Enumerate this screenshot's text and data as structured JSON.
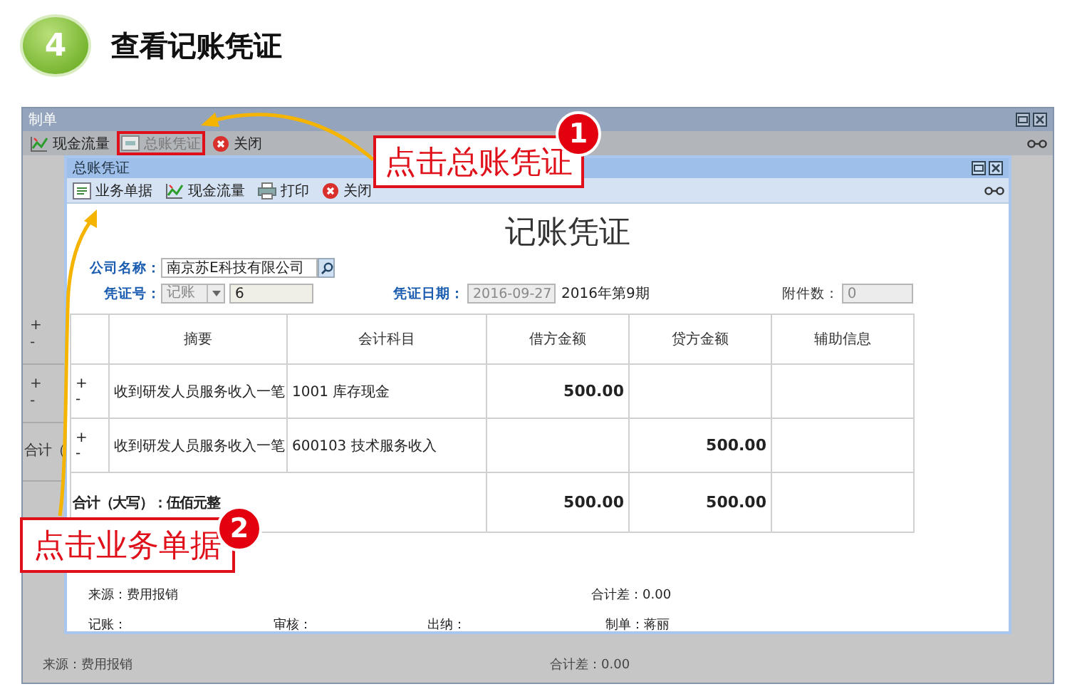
{
  "step": {
    "number": "4",
    "title": "查看记账凭证"
  },
  "outer_window": {
    "title": "制单",
    "toolbar": [
      {
        "label": "现金流量",
        "kind": "cashflow",
        "disabled": false,
        "highlighted": false
      },
      {
        "label": "总账凭证",
        "kind": "doc",
        "disabled": true,
        "highlighted": true
      },
      {
        "label": "关闭",
        "kind": "close",
        "disabled": false,
        "highlighted": false
      }
    ],
    "side_rows": [
      {
        "kind": "pm",
        "plus": "+",
        "minus": "-"
      },
      {
        "kind": "pm",
        "plus": "+",
        "minus": "-"
      },
      {
        "kind": "text",
        "text": "合计（"
      }
    ],
    "footer": {
      "source": "来源：费用报销",
      "diff": "合计差：0.00"
    }
  },
  "voucher_window": {
    "title": "总账凭证",
    "toolbar": [
      {
        "label": "业务单据",
        "kind": "docs",
        "disabled": false,
        "highlighted": false
      },
      {
        "label": "现金流量",
        "kind": "cashflow",
        "disabled": false,
        "highlighted": false
      },
      {
        "label": "打印",
        "kind": "print",
        "disabled": false,
        "highlighted": false
      },
      {
        "label": "关闭",
        "kind": "close",
        "disabled": false,
        "highlighted": false
      }
    ],
    "heading": "记账凭证",
    "company_label": "公司名称：",
    "company": {
      "value": "南京苏E科技有限公司",
      "disabled": false
    },
    "no_label": "凭证号：",
    "voucher_type": {
      "value": "记账",
      "disabled": true
    },
    "voucher_no": {
      "value": "6",
      "disabled": false
    },
    "date_label": "凭证日期：",
    "date": {
      "value": "2016-09-27",
      "disabled": true
    },
    "period": "2016年第9期",
    "attachments_label": "附件数：",
    "attachments": {
      "value": "0",
      "disabled": true
    },
    "columns": [
      "摘要",
      "会计科目",
      "借方金额",
      "贷方金额",
      "辅助信息"
    ],
    "rows": [
      {
        "plus": "+",
        "minus": "-",
        "summary": "收到研发人员服务收入一笔",
        "account": "1001 库存现金",
        "debit": "500.00",
        "credit": ""
      },
      {
        "plus": "+",
        "minus": "-",
        "summary": "收到研发人员服务收入一笔",
        "account": "600103 技术服务收入",
        "debit": "",
        "credit": "500.00"
      }
    ],
    "total": {
      "label": "合计（大写）：伍佰元整",
      "debit": "500.00",
      "credit": "500.00"
    },
    "source": "来源：费用报销",
    "diff": "合计差：0.00",
    "signatures": [
      "记账：",
      "审核：",
      "出纳：",
      "制单：蒋丽"
    ]
  },
  "callouts": [
    {
      "number": "1",
      "text": "点击总账凭证"
    },
    {
      "number": "2",
      "text": "点击业务单据"
    }
  ]
}
